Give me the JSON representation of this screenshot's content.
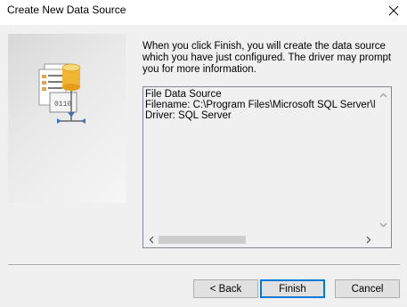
{
  "window": {
    "title": "Create New Data Source",
    "close_icon": "close-icon"
  },
  "message": "When you click Finish, you will create the data source which you have just configured.  The driver may prompt you for more information.",
  "summary": {
    "lines": [
      "File Data Source",
      "Filename:  C:\\Program Files\\Microsoft SQL Server\\MSS",
      "Driver:  SQL Server"
    ]
  },
  "buttons": {
    "back": "< Back",
    "finish": "Finish",
    "cancel": "Cancel"
  },
  "icons": {
    "wizard": "datasource-document-icon",
    "scroll_up": "chevron-up-icon",
    "scroll_down": "chevron-down-icon",
    "scroll_left": "chevron-left-icon",
    "scroll_right": "chevron-right-icon"
  },
  "colors": {
    "default_button_border": "#0078d7",
    "dialog_background": "#f0f0f0"
  }
}
